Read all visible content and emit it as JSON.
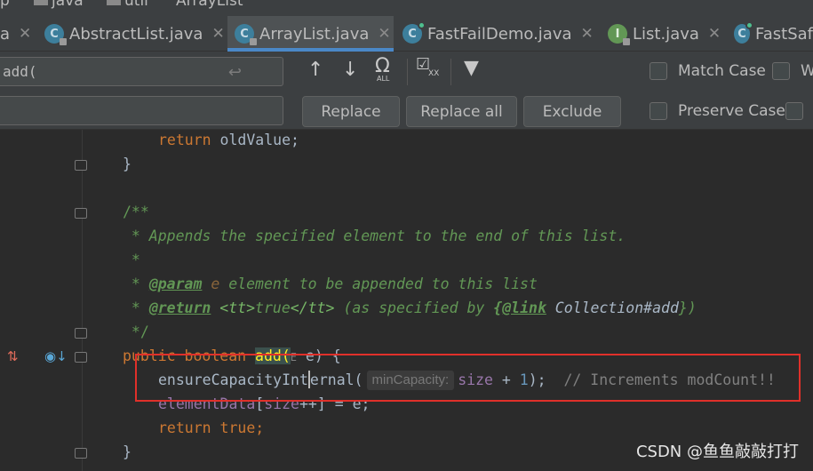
{
  "breadcrumb": {
    "items": [
      "p",
      "java",
      "util",
      "ArrayList"
    ]
  },
  "tabs": [
    {
      "label": "a",
      "icon": "class-icon",
      "closable": true,
      "active": false
    },
    {
      "label": "AbstractList.java",
      "icon": "class-icon",
      "closable": true,
      "active": false
    },
    {
      "label": "ArrayList.java",
      "icon": "class-icon",
      "closable": true,
      "active": true
    },
    {
      "label": "FastFailDemo.java",
      "icon": "runnable-class-icon",
      "closable": true,
      "active": false
    },
    {
      "label": "List.java",
      "icon": "interface-icon",
      "closable": true,
      "active": false
    },
    {
      "label": "FastSaf",
      "icon": "runnable-class-icon",
      "closable": false,
      "active": false
    }
  ],
  "find": {
    "search_value": "add(",
    "replace_value": "",
    "replace_label": "Replace",
    "replace_all_label": "Replace all",
    "exclude_label": "Exclude",
    "match_case_label": "Match Case",
    "words_label": "W",
    "preserve_case_label": "Preserve Case",
    "all_badge": "ALL",
    "x_badge": "XX"
  },
  "code": {
    "l1_kw": "return",
    "l1_rest": " oldValue;",
    "l2": "}",
    "l3": "/**",
    "l4": " * Appends the specified element to the end of this list.",
    "l5": " *",
    "l6_star": " * ",
    "l6_tag": "@param",
    "l6_param": " e",
    "l6_rest": " element to be appended to this list",
    "l7_star": " * ",
    "l7_tag": "@return",
    "l7_tt_open": " <tt>",
    "l7_true": "true",
    "l7_tt_close": "</tt>",
    "l7_mid": " (as specified by ",
    "l7_link_open": "{",
    "l7_link": "@link",
    "l7_ref": " Collection#add",
    "l7_close": "})",
    "l8": " */",
    "l9_public": "public",
    "l9_boolean": " boolean ",
    "l9_add": "add",
    "l9_paren": "(",
    "l9_type": "E",
    "l9_rest": " e) {",
    "l10_call_a": "ensureCapacityInt",
    "l10_call_b": "ernal(",
    "l10_hint": "minCapacity:",
    "l10_size": "size",
    "l10_plus": " + ",
    "l10_one": "1",
    "l10_end": ");",
    "l10_comment": "// Increments modCount!!",
    "l11_field": "elementData",
    "l11_b1": "[",
    "l11_size": "size",
    "l11_rest": "++] = e;",
    "l12_kw": "return",
    "l12_true": " true",
    "l12_end": ";",
    "l13": "}"
  },
  "watermark": "CSDN @鱼鱼敲敲打打",
  "colors": {
    "background": "#2b2b2b",
    "keyword": "#cc7832",
    "doc_comment": "#629755",
    "highlight_box": "#e0302a",
    "tab_underline": "#4a88c7"
  }
}
